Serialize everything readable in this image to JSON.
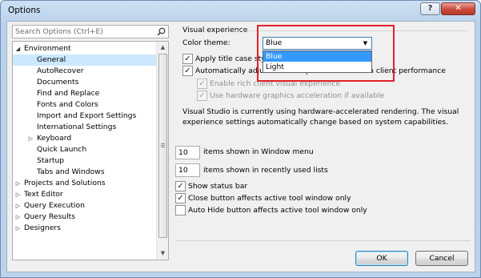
{
  "window": {
    "title": "Options",
    "help_label": "?",
    "close_label": "✕"
  },
  "search": {
    "placeholder": "Search Options (Ctrl+E)"
  },
  "tree": {
    "items": [
      {
        "label": "Environment",
        "expanded": true
      },
      {
        "label": "General",
        "selected": true
      },
      {
        "label": "AutoRecover"
      },
      {
        "label": "Documents"
      },
      {
        "label": "Find and Replace"
      },
      {
        "label": "Fonts and Colors"
      },
      {
        "label": "Import and Export Settings"
      },
      {
        "label": "International Settings"
      },
      {
        "label": "Keyboard",
        "collapsed": true
      },
      {
        "label": "Quick Launch"
      },
      {
        "label": "Startup"
      },
      {
        "label": "Tabs and Windows"
      },
      {
        "label": "Projects and Solutions",
        "collapsed": true
      },
      {
        "label": "Text Editor",
        "collapsed": true
      },
      {
        "label": "Query Execution",
        "collapsed": true
      },
      {
        "label": "Query Results",
        "collapsed": true
      },
      {
        "label": "Designers",
        "collapsed": true
      }
    ]
  },
  "visual": {
    "group_label": "Visual experience",
    "color_theme_label": "Color theme:",
    "color_theme_value": "Blue",
    "color_theme_options": [
      "Blue",
      "Light"
    ],
    "apply_title_case": {
      "label": "Apply title case stylin",
      "checked": true
    },
    "auto_adjust": {
      "label": "Automatically adjust visual experience based on client performance",
      "checked": true
    },
    "rich_client": {
      "label": "Enable rich client visual experience",
      "checked": true
    },
    "hw_accel": {
      "label": "Use hardware graphics acceleration if available",
      "checked": true
    },
    "info_line1": "Visual Studio is currently using hardware-accelerated rendering. The visual",
    "info_line2": "experience settings automatically change based on system capabilities."
  },
  "window_menu": {
    "value": "10",
    "label": "items shown in Window menu"
  },
  "recent_lists": {
    "value": "10",
    "label": "items shown in recently used lists"
  },
  "options": {
    "show_status_bar": {
      "label": "Show status bar",
      "checked": true
    },
    "close_button": {
      "label": "Close button affects active tool window only",
      "checked": true
    },
    "auto_hide": {
      "label": "Auto Hide button affects active tool window only",
      "checked": false
    }
  },
  "buttons": {
    "ok": "OK",
    "cancel": "Cancel"
  },
  "colors": {
    "highlight": "#3399ff",
    "selection": "#cce8ff",
    "annotation": "#e0222b"
  }
}
